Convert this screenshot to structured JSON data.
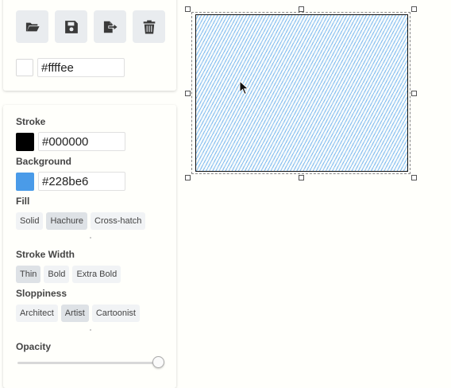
{
  "toolbar": {
    "buttons": [
      {
        "name": "open",
        "icon": "folder-open-icon"
      },
      {
        "name": "save",
        "icon": "floppy-disk-icon"
      },
      {
        "name": "export",
        "icon": "file-export-icon"
      },
      {
        "name": "clear",
        "icon": "trash-icon"
      }
    ]
  },
  "canvas_background": {
    "value": "#ffffee",
    "swatch_color": "#ffffff"
  },
  "properties": {
    "stroke": {
      "label": "Stroke",
      "value": "#000000",
      "swatch_color": "#000000"
    },
    "background": {
      "label": "Background",
      "value": "#228be6",
      "swatch_color": "#4a9be8"
    },
    "fill": {
      "label": "Fill",
      "options": [
        "Solid",
        "Hachure",
        "Cross-hatch"
      ],
      "selected": "Hachure"
    },
    "stroke_width": {
      "label": "Stroke Width",
      "options": [
        "Thin",
        "Bold",
        "Extra Bold"
      ],
      "selected": "Thin"
    },
    "sloppiness": {
      "label": "Sloppiness",
      "options": [
        "Architect",
        "Artist",
        "Cartoonist"
      ],
      "selected": "Artist"
    },
    "opacity": {
      "label": "Opacity",
      "value": 1.0
    }
  },
  "canvas": {
    "shape": {
      "type": "rectangle",
      "stroke": "#000000",
      "fill": "#228be6",
      "fill_style": "hachure",
      "selected": true
    }
  }
}
